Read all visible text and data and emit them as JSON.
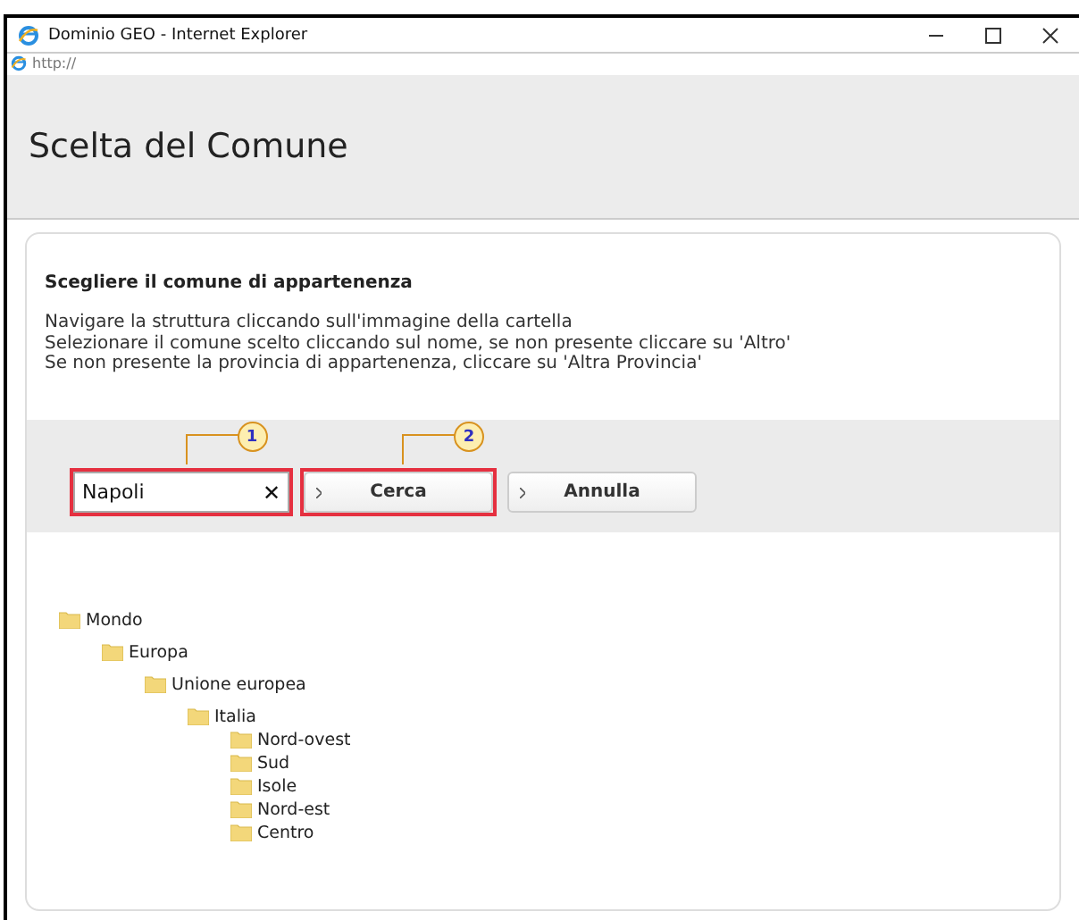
{
  "window": {
    "title": "Dominio GEO - Internet Explorer",
    "address": "http://"
  },
  "page": {
    "title": "Scelta del Comune"
  },
  "panel": {
    "heading": "Scegliere il comune di appartenenza",
    "instructions": [
      "Navigare la struttura cliccando sull'immagine della cartella",
      "Selezionare il comune scelto cliccando sul nome, se non presente cliccare su 'Altro'",
      "Se non presente la provincia di appartenenza, cliccare su 'Altra Provincia'"
    ]
  },
  "controls": [
    {
      "kind": "field",
      "value": "Napoli",
      "clear": "✕",
      "highlighted": true,
      "callout": "1"
    },
    {
      "kind": "button",
      "label": "Cerca",
      "highlighted": true,
      "callout": "2"
    },
    {
      "kind": "button",
      "label": "Annulla",
      "highlighted": false
    }
  ],
  "tree": [
    {
      "label": "Mondo",
      "children": [
        {
          "label": "Europa",
          "children": [
            {
              "label": "Unione europea",
              "children": [
                {
                  "label": "Italia",
                  "children": [
                    {
                      "label": "Nord-ovest"
                    },
                    {
                      "label": "Sud"
                    },
                    {
                      "label": "Isole"
                    },
                    {
                      "label": "Nord-est"
                    },
                    {
                      "label": "Centro"
                    }
                  ]
                }
              ]
            }
          ]
        }
      ]
    }
  ]
}
